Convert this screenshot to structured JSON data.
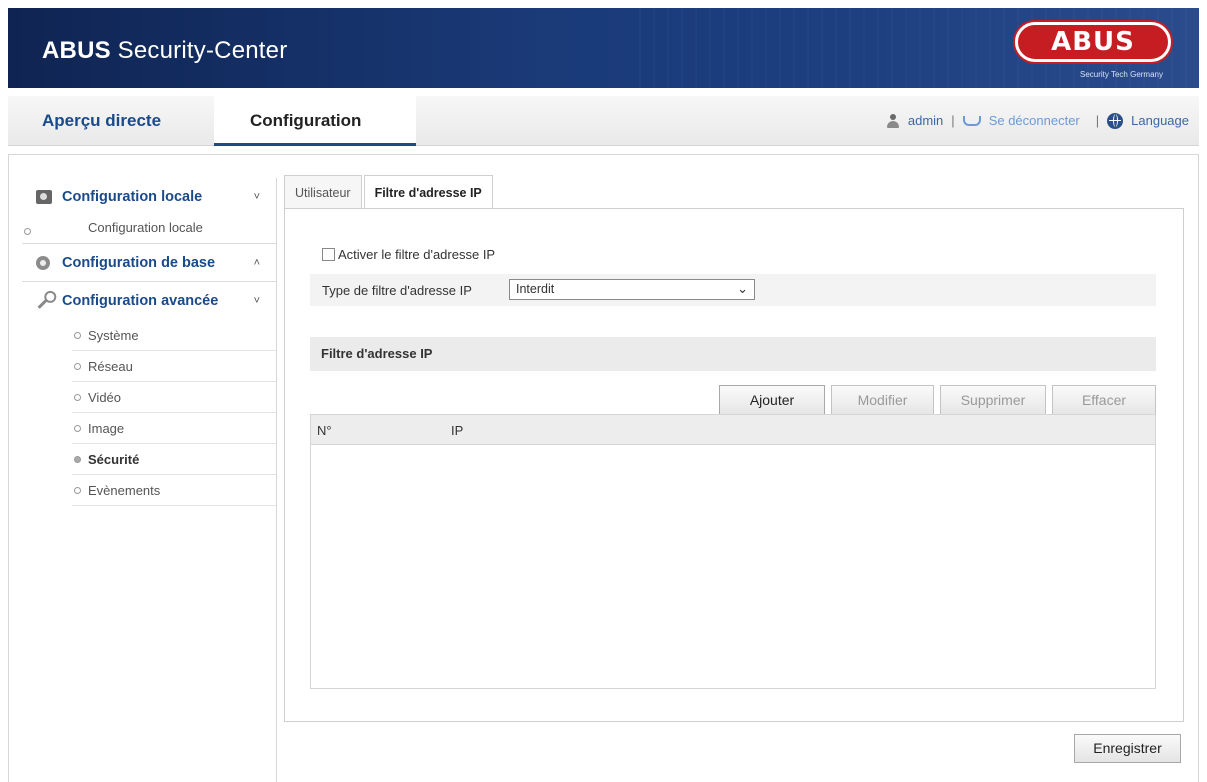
{
  "header": {
    "title_bold": "ABUS",
    "title_rest": " Security-Center",
    "logo_text": "ABUS",
    "logo_subtitle": "Security Tech Germany"
  },
  "nav": {
    "tabs": [
      {
        "label": "Aperçu directe",
        "active": false
      },
      {
        "label": "Configuration",
        "active": true
      }
    ],
    "user": "admin",
    "separator": "|",
    "logout": "Se déconnecter",
    "language": "Language"
  },
  "sidebar": {
    "groups": [
      {
        "label": "Configuration locale",
        "icon": "camera-icon",
        "chevron": "˅",
        "items": [
          {
            "label": "Configuration locale"
          }
        ]
      },
      {
        "label": "Configuration de base",
        "icon": "gear-icon",
        "chevron": "˄",
        "items": []
      },
      {
        "label": "Configuration avancée",
        "icon": "wrench-icon",
        "chevron": "˅",
        "items": [
          {
            "label": "Système"
          },
          {
            "label": "Réseau"
          },
          {
            "label": "Vidéo"
          },
          {
            "label": "Image"
          },
          {
            "label": "Sécurité",
            "active": true
          },
          {
            "label": "Evènements"
          }
        ]
      }
    ]
  },
  "tabs": [
    {
      "label": "Utilisateur",
      "active": false
    },
    {
      "label": "Filtre d'adresse IP",
      "active": true
    }
  ],
  "form": {
    "enable_label": "Activer le filtre d'adresse IP",
    "enable_checked": false,
    "type_label": "Type de filtre d'adresse IP",
    "type_value": "Interdit"
  },
  "section": {
    "title": "Filtre d'adresse IP",
    "buttons": {
      "add": "Ajouter",
      "modify": "Modifier",
      "delete": "Supprimer",
      "clear": "Effacer"
    },
    "columns": {
      "no": "N°",
      "ip": "IP"
    },
    "rows": []
  },
  "save_label": "Enregistrer",
  "colors": {
    "accent": "#1a4a8a",
    "header_bg": "#1a3a78",
    "logo": "#c61d23"
  }
}
